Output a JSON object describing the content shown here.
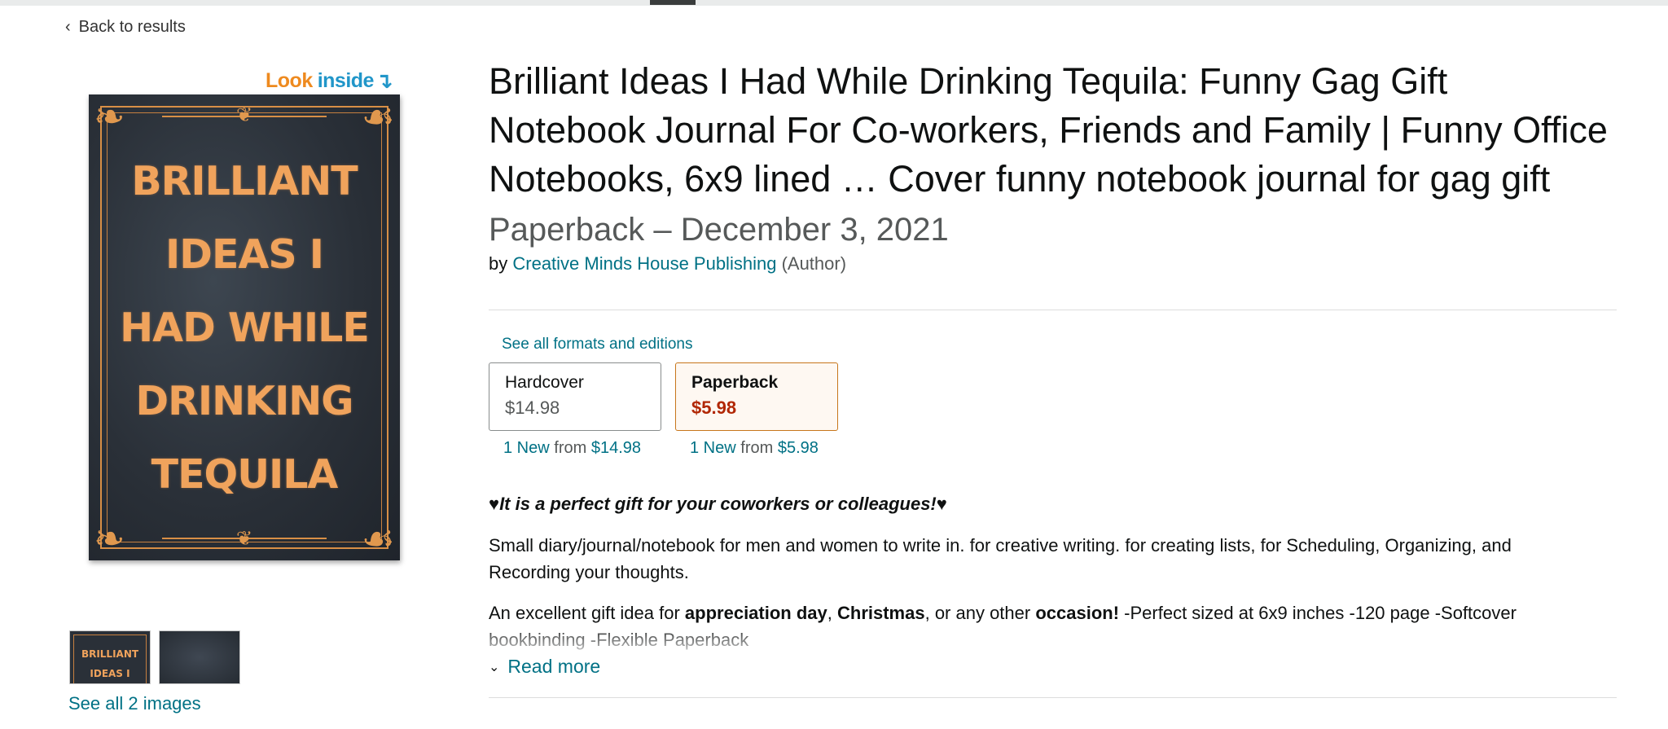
{
  "nav": {
    "back_label": "Back to results"
  },
  "gallery": {
    "look_inside_word1": "Look",
    "look_inside_word2": "inside",
    "cover_lines": [
      "BRILLIANT",
      "IDEAS I",
      "HAD WHILE",
      "DRINKING",
      "TEQUILA"
    ],
    "thumb_lines": [
      "BRILLIANT",
      "IDEAS I"
    ],
    "see_all_label": "See all 2 images"
  },
  "product": {
    "title": "Brilliant Ideas I Had While Drinking Tequila: Funny Gag Gift Notebook Journal For Co-workers, Friends and Family | Funny Office Notebooks, 6x9 lined … Cover funny notebook journal for gag gift",
    "format_date": "Paperback – December 3, 2021",
    "by_label": "by",
    "author": "Creative Minds House Publishing",
    "author_role": "(Author)"
  },
  "formats": {
    "see_all_label": "See all formats and editions",
    "options": [
      {
        "name": "Hardcover",
        "price": "$14.98",
        "offer_new": "1 New",
        "offer_from": "from",
        "offer_price": "$14.98"
      },
      {
        "name": "Paperback",
        "price": "$5.98",
        "offer_new": "1 New",
        "offer_from": "from",
        "offer_price": "$5.98",
        "selected": true
      }
    ]
  },
  "description": {
    "tagline": "♥It is a perfect gift for your coworkers or colleagues!♥",
    "p1": "Small diary/journal/notebook for men and women to write in. for creative writing. for creating lists, for Scheduling, Organizing, and Recording your thoughts.",
    "p2_a": "An excellent gift idea for ",
    "p2_b": "appreciation day",
    "p2_c": ", ",
    "p2_d": "Christmas",
    "p2_e": ", or any other ",
    "p2_f": "occasion!",
    "p2_g": " -Perfect sized at 6x9 inches -120 page -Softcover bookbinding -Flexible Paperback",
    "read_more_label": "Read more"
  },
  "colors": {
    "link": "#007185",
    "price_selected": "#b12704",
    "selected_border": "#c7761b",
    "cover_text": "#f0a35c"
  }
}
